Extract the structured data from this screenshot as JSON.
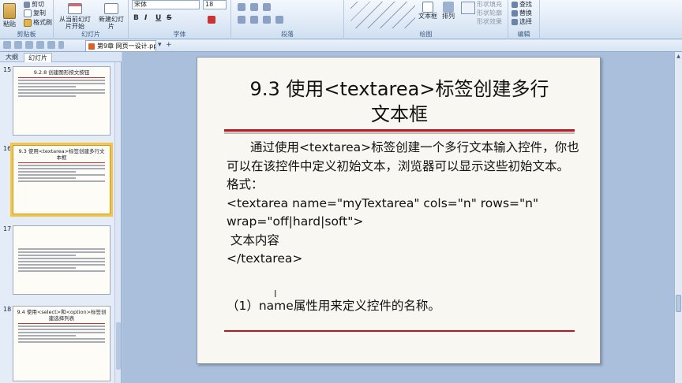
{
  "ribbon": {
    "paste_label": "粘贴",
    "cut_label": "剪切",
    "copy_label": "复制",
    "format_painter_label": "格式刷",
    "clipboard_group": "剪贴板",
    "from_current_label": "从当前幻灯片开始",
    "new_slide_label": "新建幻灯片",
    "slides_group": "幻灯片",
    "font_name": "宋体",
    "font_size": "18",
    "font_group": "字体",
    "paragraph_group": "段落",
    "drawing_group": "绘图",
    "textbox_label": "文本框",
    "arrange_label": "排列",
    "shape_fill_label": "形状填充",
    "shape_outline_label": "形状轮廓",
    "shape_effect_label": "形状效果",
    "find_label": "查找",
    "replace_label": "替换",
    "select_label": "选择",
    "edit_group": "编辑",
    "bold": "B",
    "italic": "I",
    "underline": "U",
    "strike": "S"
  },
  "tabs": {
    "document_tab": "第9章 网页一设计.ppt",
    "add_tab": "+",
    "dropdown": "▾"
  },
  "left_panel": {
    "tab_outline": "大纲",
    "tab_slides": "幻灯片",
    "thumbnails": [
      {
        "number": "15",
        "title": "9.2.8 创建图形按文按钮"
      },
      {
        "number": "16",
        "title": "9.3 使用<textarea>标签创建多行文本框"
      },
      {
        "number": "17",
        "title": ""
      },
      {
        "number": "18",
        "title": "9.4 使用<select>和<option>标签创建选择列表"
      }
    ]
  },
  "slide": {
    "title_line1": "9.3 使用<textarea>标签创建多行",
    "title_line2": "文本框",
    "paragraph": "通过使用<textarea>标签创建一个多行文本输入控件，你也可以在该控件中定义初始文本，浏览器可以显示这些初始文本。",
    "format_label": "格式：",
    "code_line1": "<textarea name=\"myTextarea\" cols=\"n\" rows=\"n\"",
    "code_line2": "wrap=\"off|hard|soft\">",
    "code_line3": " 文本内容",
    "code_line4": "</textarea>",
    "note": "（1）name属性用来定义控件的名称。"
  }
}
